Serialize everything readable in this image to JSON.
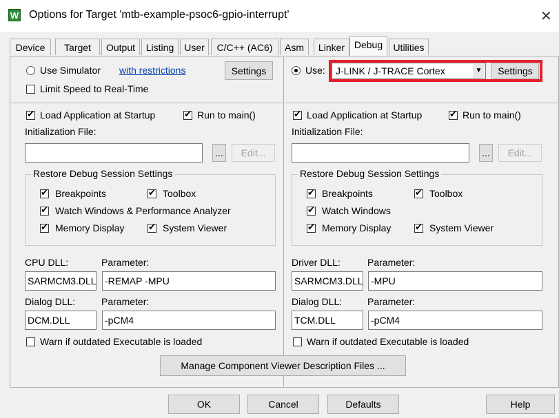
{
  "window": {
    "title": "Options for Target 'mtb-example-psoc6-gpio-interrupt'",
    "icon": "keil-uvision-icon",
    "close_glyph": "✕"
  },
  "tabs": [
    {
      "label": "Device"
    },
    {
      "label": "Target"
    },
    {
      "label": "Output"
    },
    {
      "label": "Listing"
    },
    {
      "label": "User"
    },
    {
      "label": "C/C++ (AC6)"
    },
    {
      "label": "Asm"
    },
    {
      "label": "Linker"
    },
    {
      "label": "Debug",
      "active": true
    },
    {
      "label": "Utilities"
    }
  ],
  "left": {
    "use_simulator": "Use Simulator",
    "with_restrictions": "with restrictions",
    "settings": "Settings",
    "limit_speed": "Limit Speed to Real-Time",
    "load_app": "Load Application at Startup",
    "run_to_main": "Run to main()",
    "init_file_label": "Initialization File:",
    "init_file_value": "",
    "browse": "...",
    "edit": "Edit...",
    "restore_title": "Restore Debug Session Settings",
    "breakpoints": "Breakpoints",
    "toolbox": "Toolbox",
    "watch_windows": "Watch Windows & Performance Analyzer",
    "memory_display": "Memory Display",
    "system_viewer": "System Viewer",
    "dll_label": "CPU DLL:",
    "param_label": "Parameter:",
    "dll_value": "SARMCM3.DLL",
    "dll_param": "-REMAP -MPU",
    "dialog_dll_label": "Dialog DLL:",
    "dialog_param_label": "Parameter:",
    "dialog_dll_value": "DCM.DLL",
    "dialog_param": "-pCM4",
    "warn": "Warn if outdated Executable is loaded"
  },
  "right": {
    "use": "Use:",
    "driver": "J-LINK / J-TRACE Cortex",
    "settings": "Settings",
    "load_app": "Load Application at Startup",
    "run_to_main": "Run to main()",
    "init_file_label": "Initialization File:",
    "init_file_value": "",
    "browse": "...",
    "edit": "Edit...",
    "restore_title": "Restore Debug Session Settings",
    "breakpoints": "Breakpoints",
    "toolbox": "Toolbox",
    "watch_windows": "Watch Windows",
    "memory_display": "Memory Display",
    "system_viewer": "System Viewer",
    "dll_label": "Driver DLL:",
    "param_label": "Parameter:",
    "dll_value": "SARMCM3.DLL",
    "dll_param": "-MPU",
    "dialog_dll_label": "Dialog DLL:",
    "dialog_param_label": "Parameter:",
    "dialog_dll_value": "TCM.DLL",
    "dialog_param": "-pCM4",
    "warn": "Warn if outdated Executable is loaded"
  },
  "manage_button": "Manage Component Viewer Description Files ...",
  "footer": {
    "ok": "OK",
    "cancel": "Cancel",
    "defaults": "Defaults",
    "help": "Help"
  },
  "colors": {
    "highlight": "#e5202a",
    "link": "#0645ad"
  }
}
